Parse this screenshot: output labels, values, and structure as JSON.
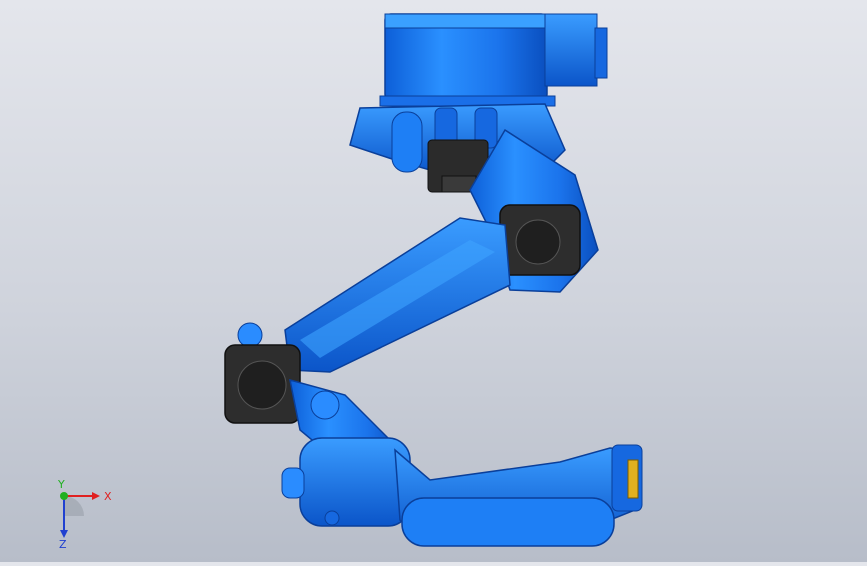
{
  "viewport": {
    "background_top": "#e4e6ec",
    "background_bottom": "#b7bdc9",
    "model_color": "#1e7ff5",
    "model_dark": "#0b4fc4",
    "motor_color": "#2b2b2b"
  },
  "triad": {
    "x_label": "X",
    "y_label": "Y",
    "z_label": "Z",
    "x_color": "#e02020",
    "y_color": "#20b020",
    "z_color": "#2040d0"
  }
}
